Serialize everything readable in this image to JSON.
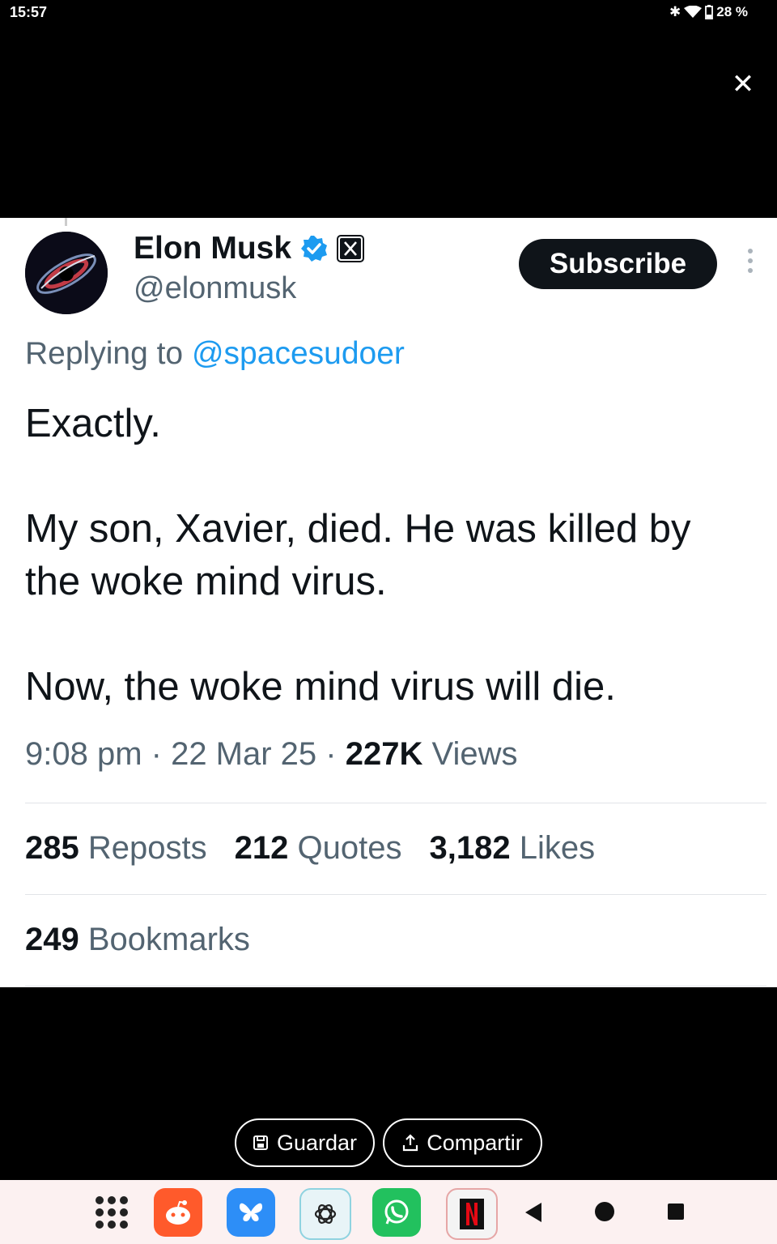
{
  "status_bar": {
    "time": "15:57",
    "battery": "28 %"
  },
  "tweet": {
    "author_name": "Elon Musk",
    "author_handle": "@elonmusk",
    "subscribe_label": "Subscribe",
    "replying_prefix": "Replying to",
    "replying_handle": "@spacesudoer",
    "text_lines": [
      "Exactly.",
      "My son, Xavier, died. He was killed by the woke mind virus.",
      "Now, the woke mind virus will die."
    ],
    "time": "9:08 pm",
    "date": "22 Mar 25",
    "views_count": "227K",
    "views_label": "Views",
    "reposts_count": "285",
    "reposts_label": "Reposts",
    "quotes_count": "212",
    "quotes_label": "Quotes",
    "likes_count": "3,182",
    "likes_label": "Likes",
    "bookmarks_count": "249",
    "bookmarks_label": "Bookmarks"
  },
  "actions": {
    "save_label": "Guardar",
    "share_label": "Compartir"
  },
  "colors": {
    "verified": "#1d9bf0",
    "link": "#1d9bf0",
    "text": "#0f1419",
    "muted": "#536471"
  },
  "nav_apps": [
    "apps-grid-icon",
    "reddit-icon",
    "bluesky-icon",
    "chatgpt-icon",
    "whatsapp-icon",
    "netflix-icon"
  ]
}
